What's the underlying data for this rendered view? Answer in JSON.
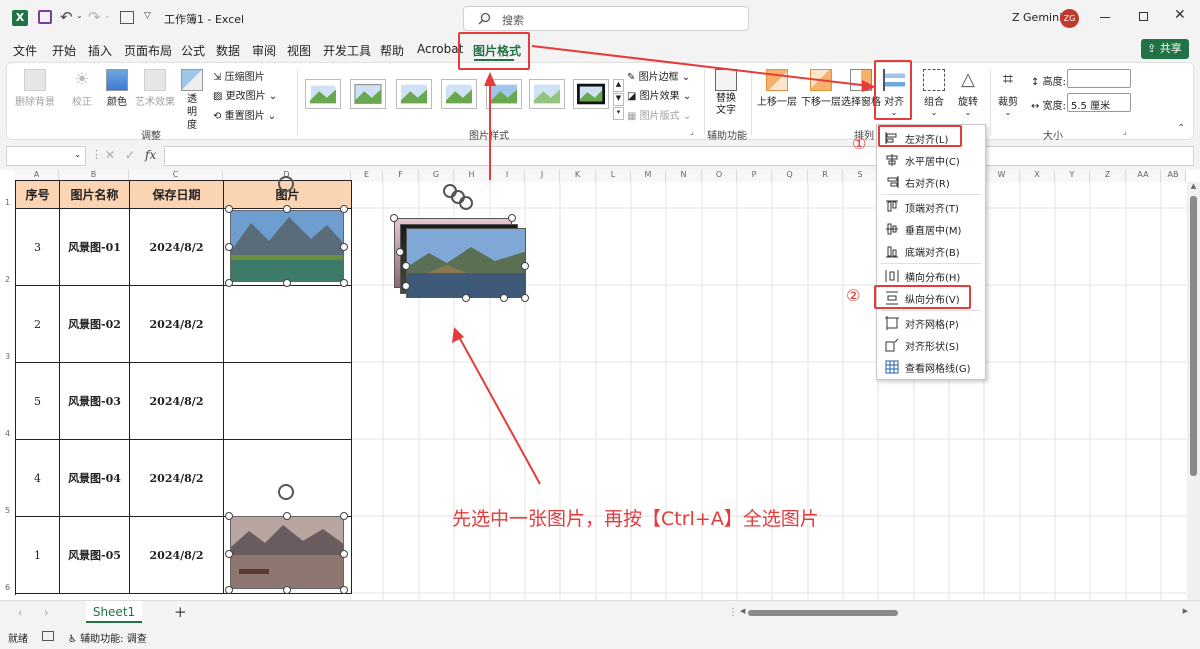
{
  "title_bar": {
    "app_title": "工作簿1 - Excel",
    "search_placeholder": "搜索",
    "user_name": "Z Gemini",
    "user_initials": "ZG"
  },
  "menu": [
    "文件",
    "开始",
    "插入",
    "页面布局",
    "公式",
    "数据",
    "审阅",
    "视图",
    "开发工具",
    "帮助",
    "Acrobat",
    "图片格式"
  ],
  "share_label": "共享",
  "ribbon": {
    "remove_bg": "删除背景",
    "correct": "校正",
    "color": "颜色",
    "art_effect": "艺术效果",
    "transparency": "透明度",
    "compress": "压缩图片",
    "change_picture": "更改图片",
    "reset_picture": "重置图片",
    "group_adjust": "调整",
    "group_styles": "图片样式",
    "picture_border": "图片边框",
    "picture_effect": "图片效果",
    "picture_layout": "图片版式",
    "alt_text": "替换文字",
    "group_accessibility": "辅助功能",
    "bring_forward": "上移一层",
    "send_backward": "下移一层",
    "selection_pane": "选择窗格",
    "align": "对齐",
    "group": "组合",
    "rotate": "旋转",
    "group_arrange": "排列",
    "crop": "裁剪",
    "height_label": "高度:",
    "height_value": "",
    "width_label": "宽度:",
    "width_value": "5.5 厘米",
    "group_size": "大小"
  },
  "formula_bar": {
    "name_box": "",
    "fx": "fx"
  },
  "columns": [
    "A",
    "B",
    "C",
    "D",
    "E",
    "F",
    "G",
    "H",
    "I",
    "J",
    "K",
    "L",
    "M",
    "N",
    "O",
    "P",
    "Q",
    "R",
    "S",
    "T",
    "U",
    "V",
    "W",
    "X",
    "Y",
    "Z",
    "AA",
    "AB",
    "AC"
  ],
  "rows": [
    "1",
    "2",
    "3",
    "4",
    "5",
    "6"
  ],
  "table": {
    "headers": [
      "序号",
      "图片名称",
      "保存日期",
      "图片"
    ],
    "rows": [
      [
        "3",
        "风景图-01",
        "2024/8/2"
      ],
      [
        "2",
        "风景图-02",
        "2024/8/2"
      ],
      [
        "5",
        "风景图-03",
        "2024/8/2"
      ],
      [
        "4",
        "风景图-04",
        "2024/8/2"
      ],
      [
        "1",
        "风景图-05",
        "2024/8/2"
      ]
    ]
  },
  "align_menu": [
    {
      "label": "左对齐(L)",
      "icon": "align-left-icon"
    },
    {
      "label": "水平居中(C)",
      "icon": "align-center-icon"
    },
    {
      "label": "右对齐(R)",
      "icon": "align-right-icon"
    },
    {
      "label": "顶端对齐(T)",
      "icon": "align-top-icon"
    },
    {
      "label": "垂直居中(M)",
      "icon": "align-middle-icon"
    },
    {
      "label": "底端对齐(B)",
      "icon": "align-bottom-icon"
    },
    {
      "label": "横向分布(H)",
      "icon": "distribute-horizontal-icon"
    },
    {
      "label": "纵向分布(V)",
      "icon": "distribute-vertical-icon"
    },
    {
      "label": "对齐网格(P)",
      "icon": "snap-grid-icon"
    },
    {
      "label": "对齐形状(S)",
      "icon": "snap-shape-icon"
    },
    {
      "label": "查看网格线(G)",
      "icon": "view-gridlines-icon"
    }
  ],
  "annotations": {
    "step1": "①",
    "step2": "②",
    "instruction": "先选中一张图片，再按【Ctrl+A】全选图片"
  },
  "sheet_tab": "Sheet1",
  "status": {
    "ready": "就绪",
    "accessibility": "辅助功能: 调查"
  },
  "colors": {
    "accent_green": "#217346",
    "annotation_red": "#e63b3b",
    "header_fill": "#fbd4b4"
  }
}
